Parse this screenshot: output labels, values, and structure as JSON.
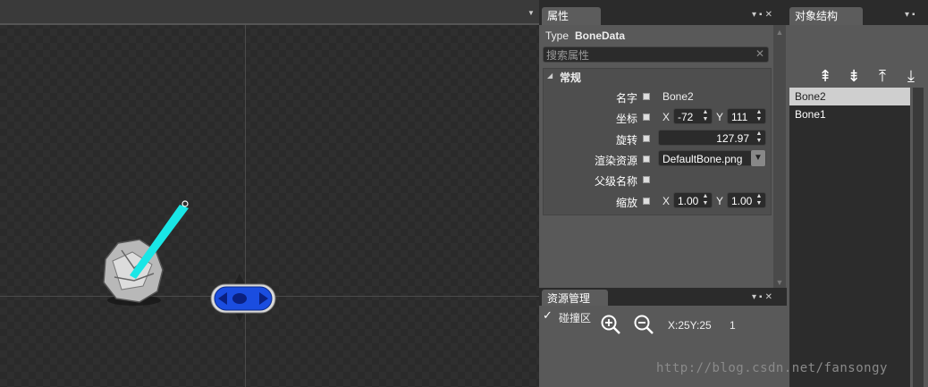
{
  "properties_panel": {
    "title": "属性",
    "type_prefix": "Type",
    "type_name": "BoneData",
    "search_placeholder": "搜索属性",
    "section": "常规",
    "name_label": "名字",
    "name_value": "Bone2",
    "position_label": "坐标",
    "x_label": "X",
    "x_value": "-72",
    "y_label": "Y",
    "y_value": "111",
    "rotation_label": "旋转",
    "rotation_value": "127.97",
    "render_label": "渲染资源",
    "render_value": "DefaultBone.png",
    "parent_label": "父级名称",
    "scale_label": "缩放",
    "scale_x_label": "X",
    "scale_x_value": "1.00",
    "scale_y_label": "Y",
    "scale_y_value": "1.00"
  },
  "structure_panel": {
    "title": "对象结构",
    "items": [
      "Bone2",
      "Bone1"
    ]
  },
  "resource_panel": {
    "title": "资源管理",
    "collision_label": "碰撞区",
    "coords": "X:25Y:25",
    "zoom": "1"
  },
  "watermark": "http://blog.csdn.net/fansongy",
  "colors": {
    "bone_beam": "#19e6e6",
    "selected_item": "#cfcfcf",
    "panel_bg": "#595959"
  }
}
